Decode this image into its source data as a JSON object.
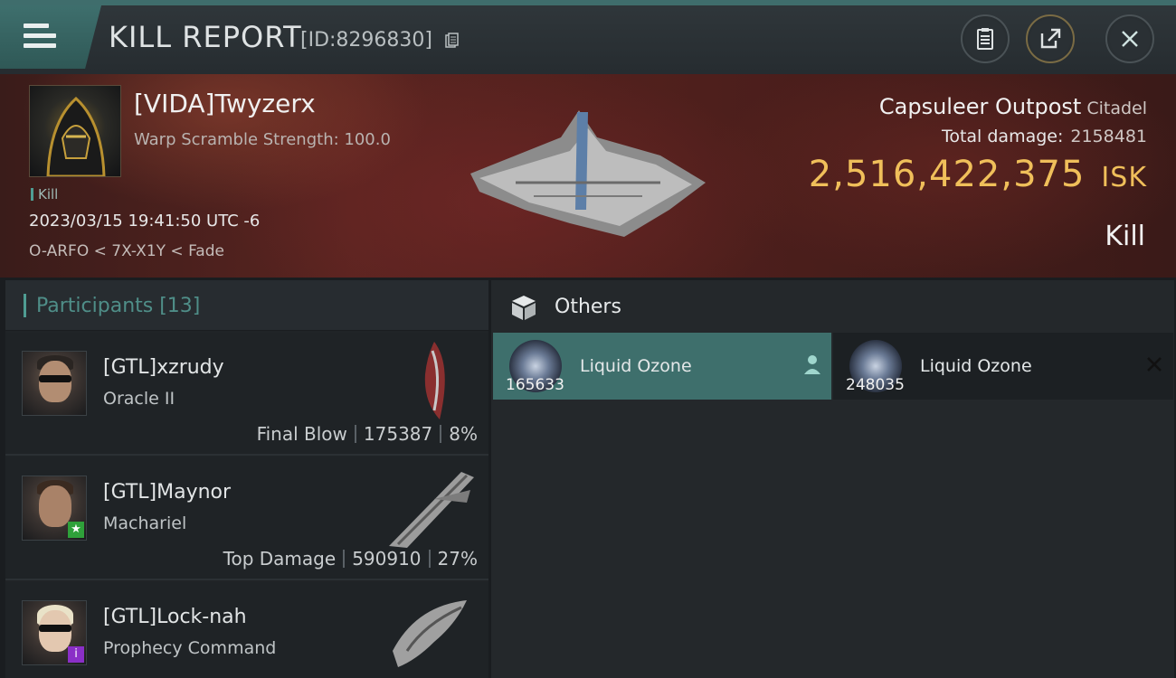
{
  "header": {
    "title": "KILL REPORT",
    "report_id": "[ID:8296830]"
  },
  "victim": {
    "name": "[VIDA]Twyzerx",
    "subtitle": "Warp Scramble Strength: 100.0",
    "tag": "Kill",
    "timestamp": "2023/03/15 19:41:50 UTC -6",
    "location": "O-ARFO < 7X-X1Y < Fade"
  },
  "target": {
    "name": "Capsuleer Outpost",
    "class": "Citadel",
    "total_damage_label": "Total damage:",
    "total_damage_value": "2158481",
    "isk_value": "2,516,422,375",
    "isk_unit": "ISK",
    "result": "Kill"
  },
  "participants": {
    "header": "Participants [13]",
    "rows": [
      {
        "name": "[GTL]xzrudy",
        "ship": "Oracle II",
        "role": "Final Blow",
        "damage": "175387",
        "percent": "8%"
      },
      {
        "name": "[GTL]Maynor",
        "ship": "Machariel",
        "role": "Top Damage",
        "damage": "590910",
        "percent": "27%"
      },
      {
        "name": "[GTL]Lock-nah",
        "ship": "Prophecy Command",
        "role": "",
        "damage": "",
        "percent": ""
      }
    ]
  },
  "others": {
    "header": "Others",
    "items": [
      {
        "name": "Liquid Ozone",
        "qty": "165633"
      },
      {
        "name": "Liquid Ozone",
        "qty": "248035"
      }
    ]
  },
  "colors": {
    "accent_teal": "#3e6f6c",
    "isk_gold": "#f0bf5a"
  }
}
